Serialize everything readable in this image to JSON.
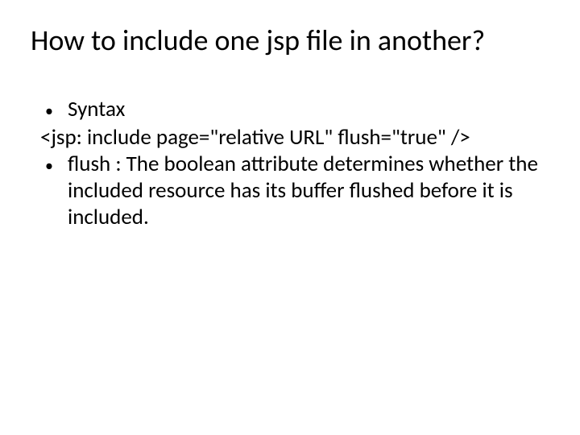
{
  "title": "How to include one jsp file in another?",
  "bullets": {
    "b1": "Syntax",
    "code": "<jsp: include page=\"relative URL\" flush=\"true\" />",
    "b2": "flush : The boolean attribute determines whether the included resource has its buffer flushed before it is included."
  }
}
